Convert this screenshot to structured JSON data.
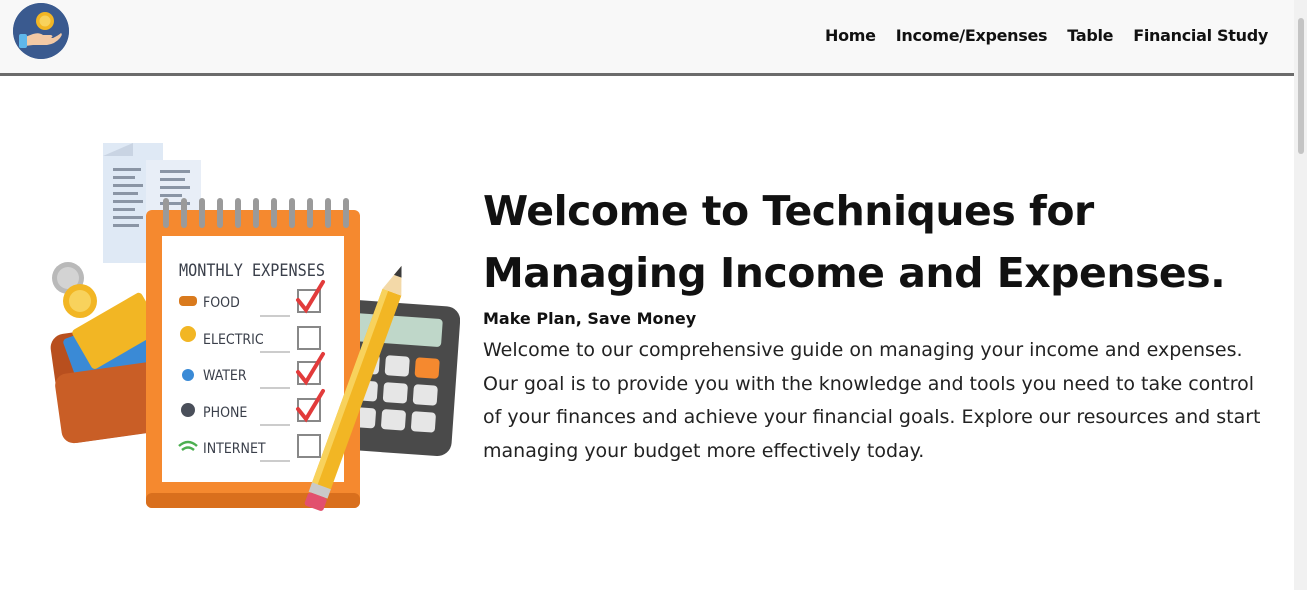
{
  "navbar": {
    "logo_icon": "hand-coin-icon",
    "links": [
      {
        "label": "Home"
      },
      {
        "label": "Income/Expenses"
      },
      {
        "label": "Table"
      },
      {
        "label": "Financial Study"
      }
    ]
  },
  "illustration": {
    "heading": "MONTHLY EXPENSES",
    "items": [
      {
        "label": "FOOD",
        "icon": "burger-icon",
        "checked": true
      },
      {
        "label": "ELECTRIC",
        "icon": "lightbulb-icon",
        "checked": false
      },
      {
        "label": "WATER",
        "icon": "water-drops-icon",
        "checked": true
      },
      {
        "label": "PHONE",
        "icon": "phone-icon",
        "checked": true
      },
      {
        "label": "INTERNET",
        "icon": "wifi-icon",
        "checked": false
      }
    ]
  },
  "hero": {
    "title_line1": "Welcome to Techniques for",
    "title_line2": "Managing Income and Expenses.",
    "subtitle": "Make Plan, Save Money",
    "body": "Welcome to our comprehensive guide on managing your income and expenses. Our goal is to provide you with the knowledge and tools you need to take control of your finances and achieve your financial goals. Explore our resources and start managing your budget more effectively today."
  },
  "colors": {
    "accent_orange": "#f5892f",
    "check_red": "#e23b3b",
    "logo_blue": "#3a5a8f",
    "coin_gold": "#f2b624"
  }
}
